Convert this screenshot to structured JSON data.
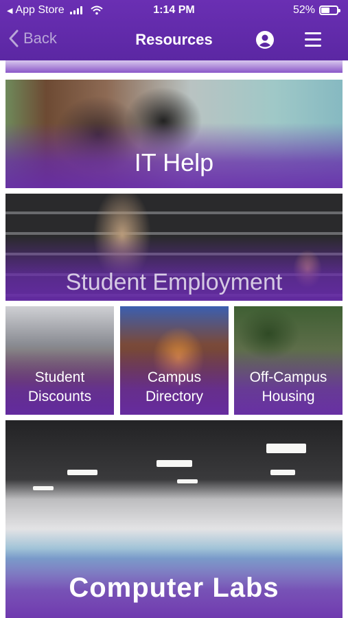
{
  "status_bar": {
    "carrier": "App Store",
    "time": "1:14 PM",
    "battery": "52%",
    "battery_level": 0.52
  },
  "nav": {
    "back_label": "Back",
    "title": "Resources",
    "profile_icon": "profile-icon",
    "menu_icon": "hamburger-menu-icon"
  },
  "tiles": {
    "it_help": "IT Help",
    "student_employment": "Student Employment",
    "student_discounts": [
      "Student",
      "Discounts"
    ],
    "campus_directory": [
      "Campus",
      "Directory"
    ],
    "off_campus_housing": [
      "Off-Campus",
      "Housing"
    ],
    "computer_labs": "Computer Labs"
  },
  "colors": {
    "brand_purple": "#5b27a3",
    "overlay_purple": "#672baa"
  }
}
